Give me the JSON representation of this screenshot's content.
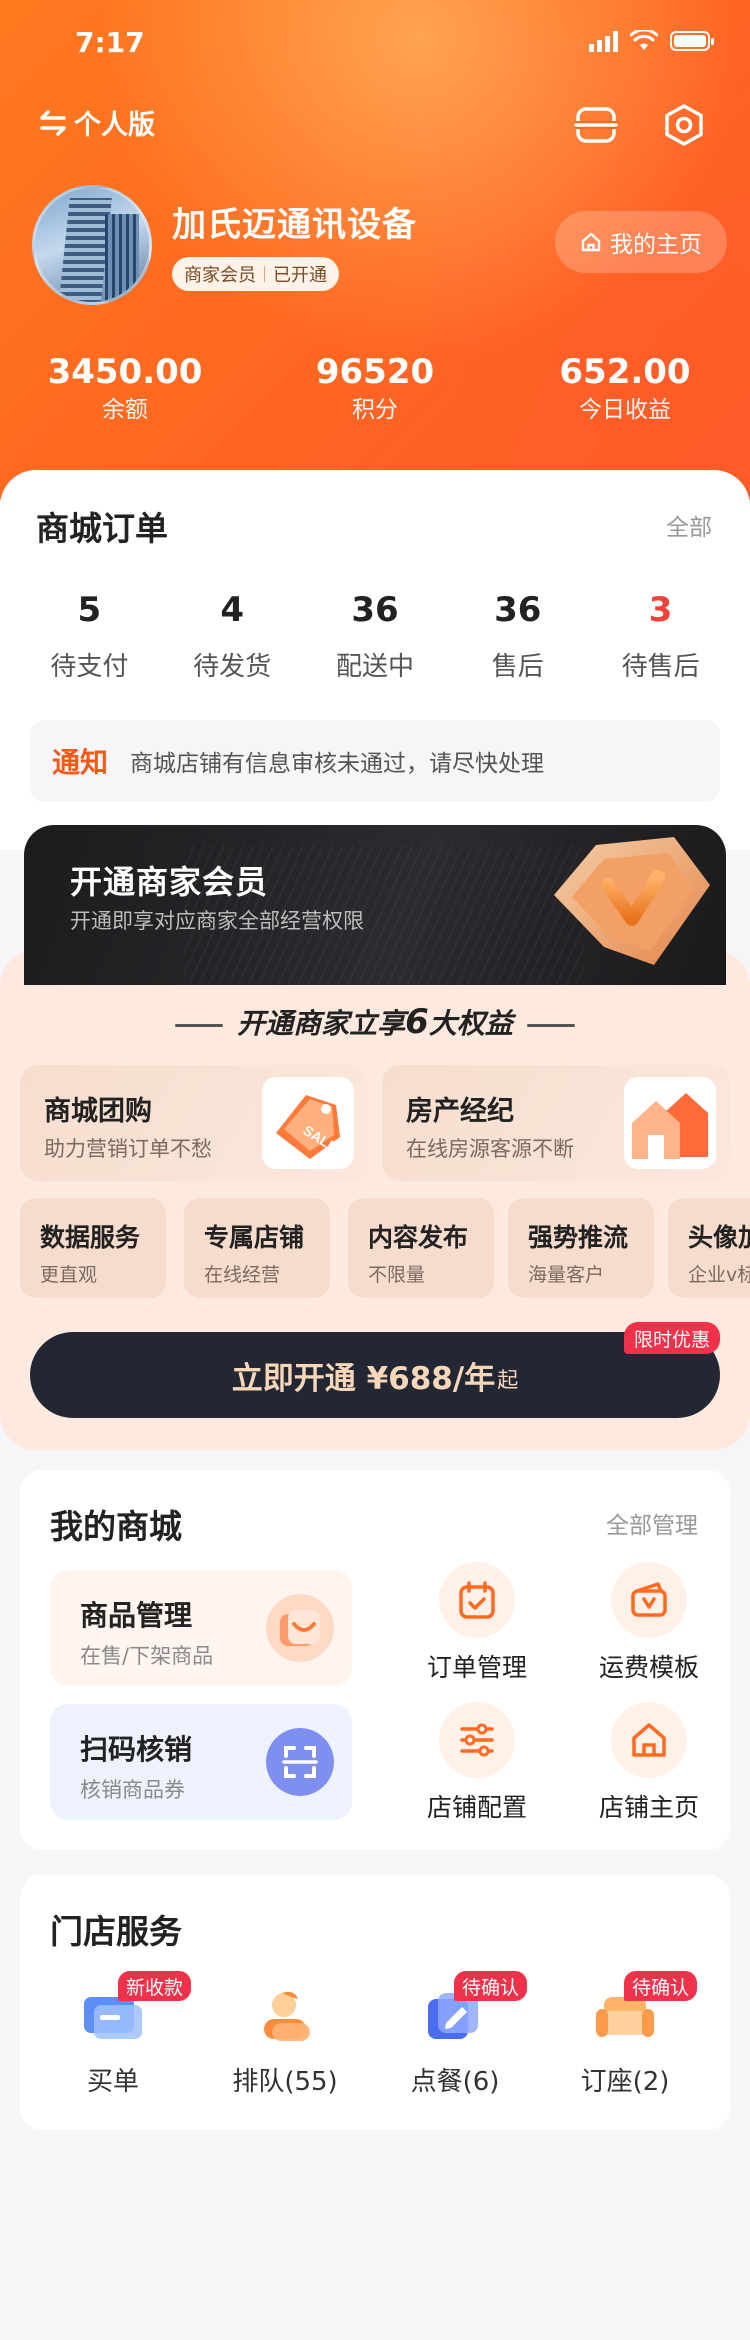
{
  "status_bar": {
    "time": "7:17"
  },
  "header": {
    "mode_label": "个人版",
    "shop_name": "加氏迈通讯设备",
    "member_level": "商家会员",
    "member_status": "已开通",
    "home_button": "我的主页",
    "stats": [
      {
        "value": "3450.00",
        "label": "余额"
      },
      {
        "value": "96520",
        "label": "积分"
      },
      {
        "value": "652.00",
        "label": "今日收益"
      }
    ]
  },
  "orders": {
    "title": "商城订单",
    "more": "全部",
    "items": [
      {
        "count": "5",
        "label": "待支付"
      },
      {
        "count": "4",
        "label": "待发货"
      },
      {
        "count": "36",
        "label": "配送中"
      },
      {
        "count": "36",
        "label": "售后"
      },
      {
        "count": "3",
        "label": "待售后"
      }
    ],
    "notice_tag": "通知",
    "notice_text": "商城店铺有信息审核未通过，请尽快处理"
  },
  "vip": {
    "title": "开通商家会员",
    "subtitle": "开通即享对应商家全部经营权限",
    "benefits_title_pre": "开通商家立享",
    "benefits_count": "6",
    "benefits_title_post": "大权益",
    "cards": [
      {
        "title": "商城团购",
        "desc": "助力营销订单不愁"
      },
      {
        "title": "房产经纪",
        "desc": "在线房源客源不断"
      }
    ],
    "minis": [
      {
        "title": "数据服务",
        "desc": "更直观"
      },
      {
        "title": "专属店铺",
        "desc": "在线经营"
      },
      {
        "title": "内容发布",
        "desc": "不限量"
      },
      {
        "title": "强势推流",
        "desc": "海量客户"
      },
      {
        "title": "头像加",
        "desc": "企业v标"
      }
    ],
    "cta_text": "立即开通 ¥688/年",
    "cta_suffix": "起",
    "limit_tag": "限时优惠"
  },
  "mall": {
    "title": "我的商城",
    "more": "全部管理",
    "cards": [
      {
        "title": "商品管理",
        "desc": "在售/下架商品"
      },
      {
        "title": "扫码核销",
        "desc": "核销商品券"
      }
    ],
    "grid": [
      {
        "label": "订单管理",
        "icon": "calendar-check-icon"
      },
      {
        "label": "运费模板",
        "icon": "wallet-v-icon"
      },
      {
        "label": "店铺配置",
        "icon": "sliders-icon"
      },
      {
        "label": "店铺主页",
        "icon": "home-icon"
      }
    ]
  },
  "store": {
    "title": "门店服务",
    "items": [
      {
        "label": "买单",
        "tag": "新收款"
      },
      {
        "label": "排队(55)",
        "tag": ""
      },
      {
        "label": "点餐(6)",
        "tag": "待确认"
      },
      {
        "label": "订座(2)",
        "tag": "待确认"
      }
    ]
  },
  "colors": {
    "brand": "#ff6a20",
    "accent_red": "#f0314a",
    "dark": "#232633"
  }
}
